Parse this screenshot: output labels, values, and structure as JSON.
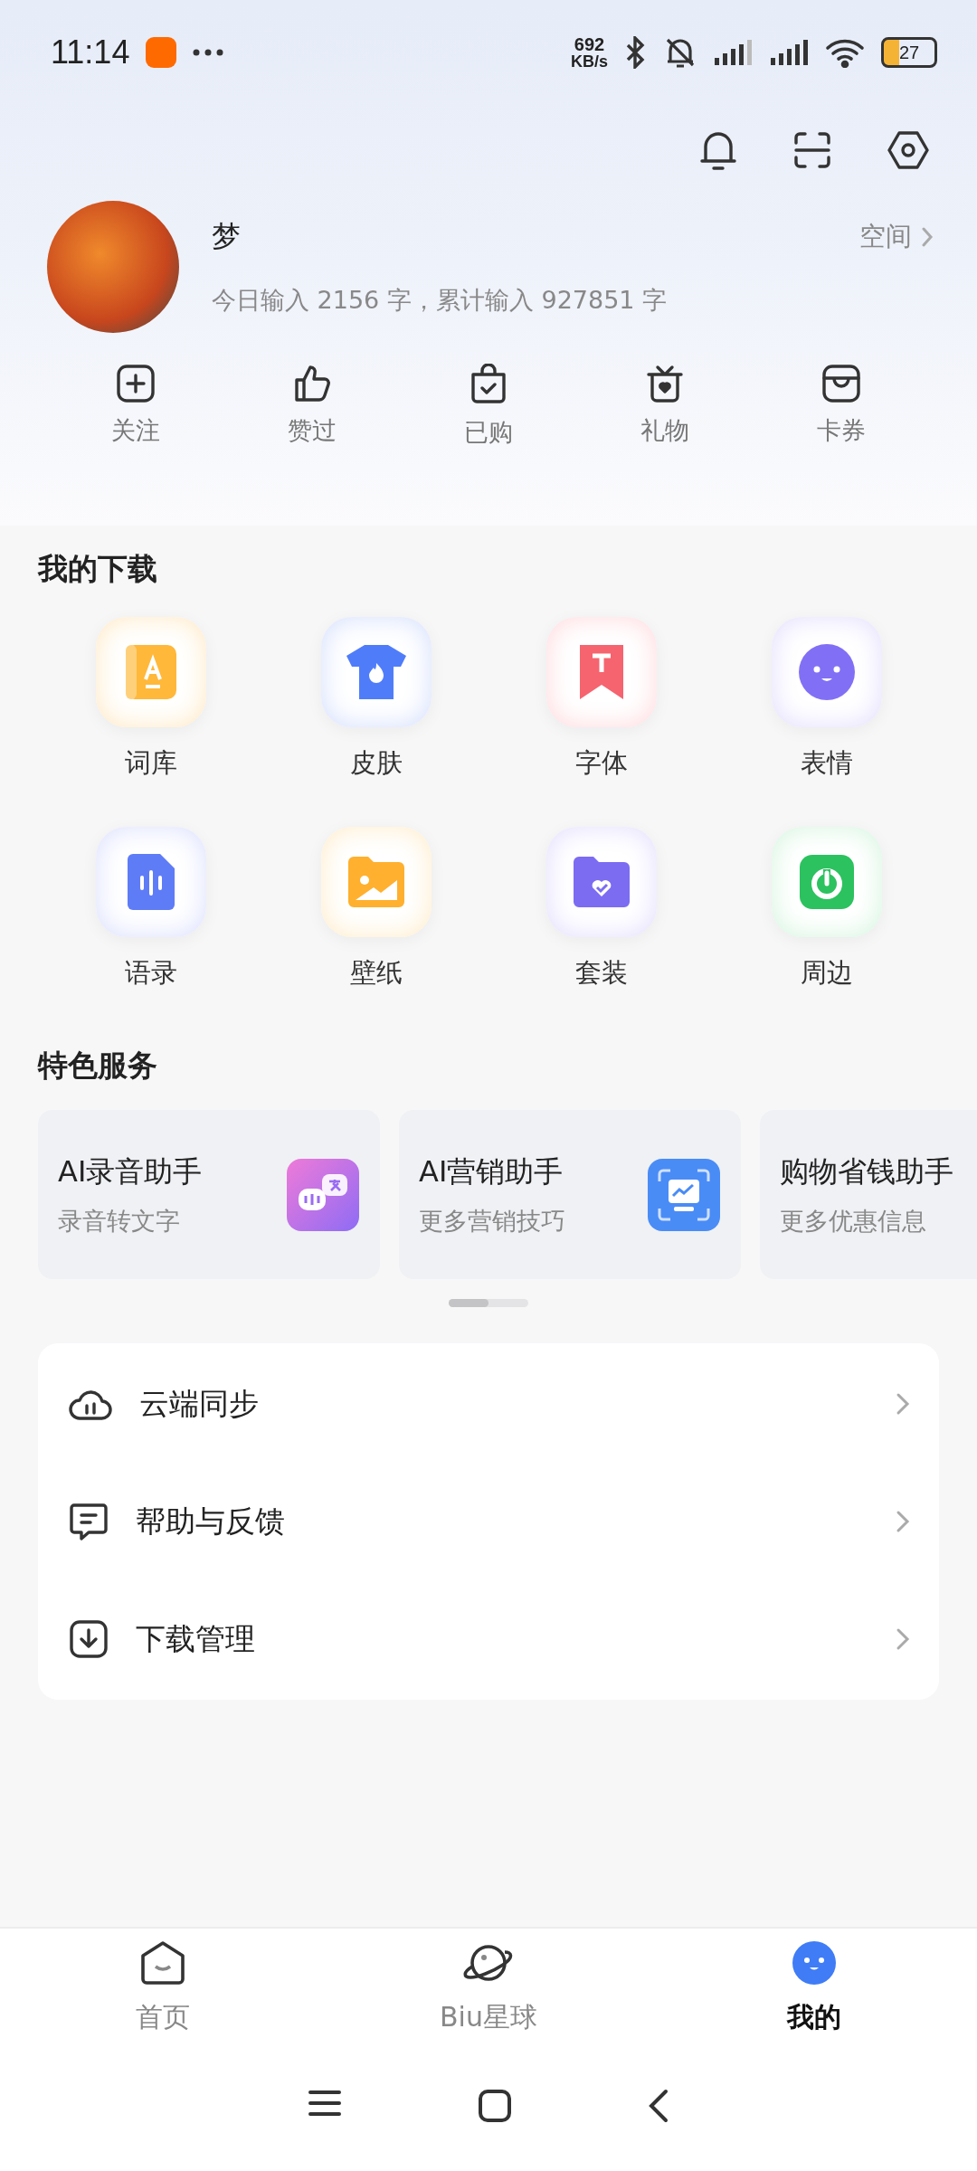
{
  "status_bar": {
    "time": "11:14",
    "net_speed_value": "692",
    "net_speed_unit": "KB/s",
    "battery": "27"
  },
  "profile": {
    "name": "梦",
    "space_link": "空间",
    "stats": "今日输入 2156 字，累计输入 927851 字"
  },
  "quick_actions": [
    {
      "label": "关注"
    },
    {
      "label": "赞过"
    },
    {
      "label": "已购"
    },
    {
      "label": "礼物"
    },
    {
      "label": "卡券"
    }
  ],
  "downloads": {
    "title": "我的下载",
    "items": [
      {
        "label": "词库"
      },
      {
        "label": "皮肤"
      },
      {
        "label": "字体"
      },
      {
        "label": "表情"
      },
      {
        "label": "语录"
      },
      {
        "label": "壁纸"
      },
      {
        "label": "套装"
      },
      {
        "label": "周边"
      }
    ]
  },
  "services": {
    "title": "特色服务",
    "cards": [
      {
        "title": "AI录音助手",
        "subtitle": "录音转文字"
      },
      {
        "title": "AI营销助手",
        "subtitle": "更多营销技巧"
      },
      {
        "title": "购物省钱助手",
        "subtitle": "更多优惠信息"
      }
    ]
  },
  "menu": [
    {
      "label": "云端同步"
    },
    {
      "label": "帮助与反馈"
    },
    {
      "label": "下载管理"
    }
  ],
  "bottom_nav": [
    {
      "label": "首页",
      "selected": false
    },
    {
      "label": "Biu星球",
      "selected": false
    },
    {
      "label": "我的",
      "selected": true
    }
  ]
}
